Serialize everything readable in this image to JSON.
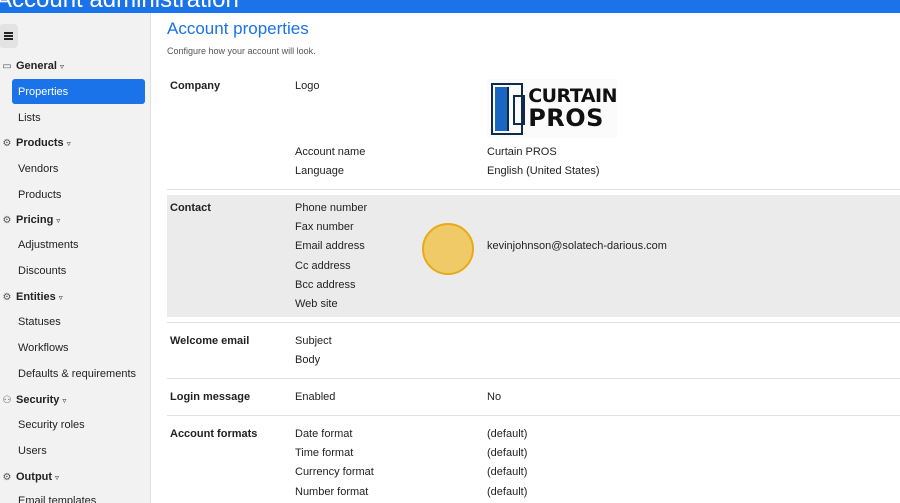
{
  "app": {
    "title": "Account administration"
  },
  "sidebar": {
    "sections": [
      {
        "label": "General",
        "icon": "monitor-icon",
        "items": [
          "Properties",
          "Lists"
        ]
      },
      {
        "label": "Products",
        "icon": "gear-icon",
        "items": [
          "Vendors",
          "Products"
        ]
      },
      {
        "label": "Pricing",
        "icon": "gear-icon",
        "items": [
          "Adjustments",
          "Discounts"
        ]
      },
      {
        "label": "Entities",
        "icon": "gear-icon",
        "items": [
          "Statuses",
          "Workflows",
          "Defaults & requirements"
        ]
      },
      {
        "label": "Security",
        "icon": "users-icon",
        "items": [
          "Security roles",
          "Users"
        ]
      },
      {
        "label": "Output",
        "icon": "gear-icon",
        "items": [
          "Email templates"
        ]
      }
    ],
    "active_item": "Properties",
    "caret": "▿"
  },
  "page": {
    "title": "Account properties",
    "subtitle": "Configure how your account will look."
  },
  "company": {
    "heading": "Company",
    "logo_label": "Logo",
    "logo_text_top": "CURTAIN",
    "logo_text_bottom": "PROS",
    "account_name_label": "Account name",
    "account_name_value": "Curtain PROS",
    "language_label": "Language",
    "language_value": "English (United States)"
  },
  "contact": {
    "heading": "Contact",
    "phone_label": "Phone number",
    "fax_label": "Fax number",
    "email_label": "Email address",
    "email_value": "kevinjohnson@solatech-darious.com",
    "cc_label": "Cc address",
    "bcc_label": "Bcc address",
    "web_label": "Web site"
  },
  "welcome_email": {
    "heading": "Welcome email",
    "subject_label": "Subject",
    "body_label": "Body"
  },
  "login_message": {
    "heading": "Login message",
    "enabled_label": "Enabled",
    "enabled_value": "No"
  },
  "account_formats": {
    "heading": "Account formats",
    "date_label": "Date format",
    "date_value": "(default)",
    "time_label": "Time format",
    "time_value": "(default)",
    "currency_label": "Currency format",
    "currency_value": "(default)",
    "number_label": "Number format",
    "number_value": "(default)"
  },
  "colors": {
    "accent": "#1a73e8",
    "highlight_row": "#ebebeb",
    "click_marker": "#f0c450"
  }
}
